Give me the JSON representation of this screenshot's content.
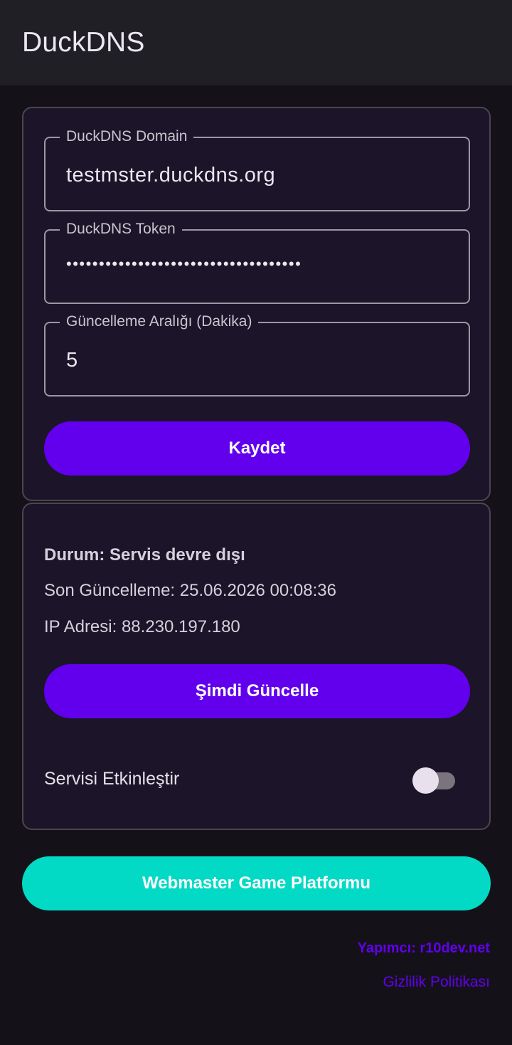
{
  "appbar": {
    "title": "DuckDNS"
  },
  "settings": {
    "domain": {
      "label": "DuckDNS Domain",
      "value": "testmster.duckdns.org"
    },
    "token": {
      "label": "DuckDNS Token",
      "value": "••••••••••••••••••••••••••••••••••••"
    },
    "interval": {
      "label": "Güncelleme Aralığı (Dakika)",
      "value": "5"
    },
    "save_label": "Kaydet"
  },
  "status": {
    "state": "Durum: Servis devre dışı",
    "last_update": "Son Güncelleme: 25.06.2026 00:08:36",
    "ip": "IP Adresi: 88.230.197.180",
    "update_now_label": "Şimdi Güncelle",
    "enable_label": "Servisi Etkinleştir",
    "enabled": false
  },
  "footer": {
    "platform_button": "Webmaster Game Platformu",
    "credit": "Yapımcı: r10dev.net",
    "privacy": "Gizlilik Politikası"
  },
  "colors": {
    "primary": "#6200ee",
    "secondary": "#03dac5",
    "background": "#141218",
    "card": "#1c1529"
  }
}
